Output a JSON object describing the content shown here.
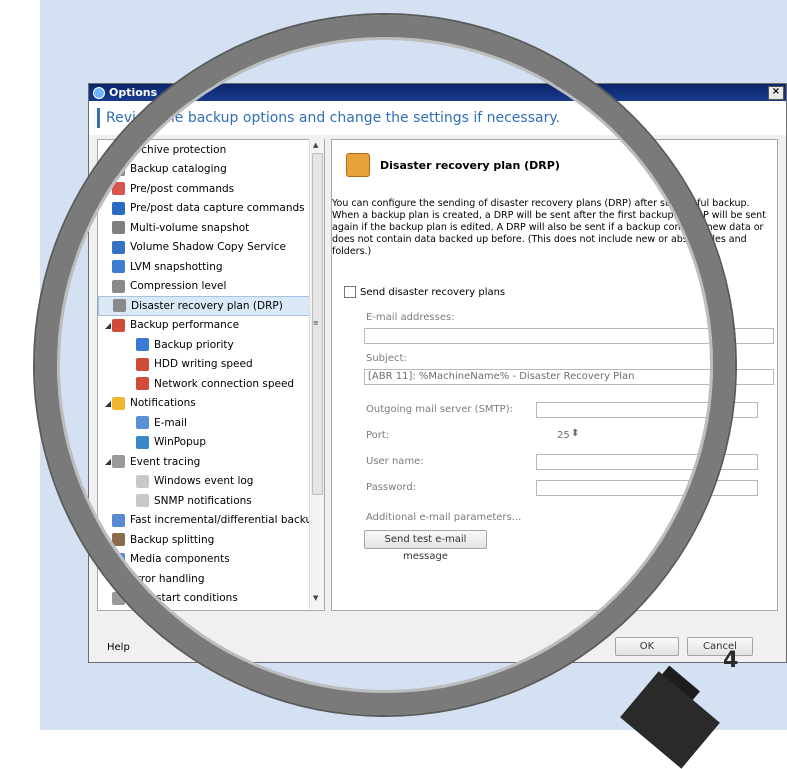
{
  "window": {
    "title": "Options",
    "close_glyph": "×"
  },
  "header": {
    "text": "Review the backup options and change the settings if necessary."
  },
  "tree": {
    "items": [
      {
        "label": "Archive protection",
        "icon": "lock-icon",
        "color": "#b38b3a",
        "level": 0
      },
      {
        "label": "Backup cataloging",
        "icon": "catalog-icon",
        "color": "#8a8a8a",
        "level": 0
      },
      {
        "label": "Pre/post commands",
        "icon": "clock-command-icon",
        "color": "#d9534f",
        "level": 0
      },
      {
        "label": "Pre/post data capture commands",
        "icon": "terminal-icon",
        "color": "#2a6cc1",
        "level": 0
      },
      {
        "label": "Multi-volume snapshot",
        "icon": "disks-icon",
        "color": "#7f7f7f",
        "level": 0
      },
      {
        "label": "Volume Shadow Copy Service",
        "icon": "vss-icon",
        "color": "#3572c6",
        "level": 0
      },
      {
        "label": "LVM snapshotting",
        "icon": "lvm-icon",
        "color": "#3c7dd1",
        "level": 0
      },
      {
        "label": "Compression level",
        "icon": "compression-icon",
        "color": "#8a8a8a",
        "level": 0
      },
      {
        "label": "Disaster recovery plan (DRP)",
        "icon": "drp-icon",
        "color": "#8a8a8a",
        "level": 0
      },
      {
        "label": "Backup performance",
        "icon": "performance-icon",
        "color": "#d14b3a",
        "level": 0,
        "expander": "◢"
      },
      {
        "label": "Backup priority",
        "icon": "priority-icon",
        "color": "#3a7bd5",
        "level": 1
      },
      {
        "label": "HDD writing speed",
        "icon": "hdd-speed-icon",
        "color": "#d14b3a",
        "level": 1
      },
      {
        "label": "Network connection speed",
        "icon": "network-speed-icon",
        "color": "#d14b3a",
        "level": 1
      },
      {
        "label": "Notifications",
        "icon": "notification-icon",
        "color": "#f2b632",
        "level": 0,
        "expander": "◢"
      },
      {
        "label": "E-mail",
        "icon": "email-icon",
        "color": "#5b8fd6",
        "level": 1
      },
      {
        "label": "WinPopup",
        "icon": "winpopup-icon",
        "color": "#3a88c9",
        "level": 1
      },
      {
        "label": "Event tracing",
        "icon": "event-trace-icon",
        "color": "#9a9a9a",
        "level": 0,
        "expander": "◢"
      },
      {
        "label": "Windows event log",
        "icon": "event-log-icon",
        "color": "#c8c8c8",
        "level": 1
      },
      {
        "label": "SNMP notifications",
        "icon": "snmp-icon",
        "color": "#c8c8c8",
        "level": 1
      },
      {
        "label": "Fast incremental/differential backup",
        "icon": "fast-backup-icon",
        "color": "#5a8ad1",
        "level": 0
      },
      {
        "label": "Backup splitting",
        "icon": "split-icon",
        "color": "#8a6b4a",
        "level": 0
      },
      {
        "label": "Media components",
        "icon": "media-icon",
        "color": "#5a8ad1",
        "level": 0
      },
      {
        "label": "Error handling",
        "icon": "error-icon",
        "color": "#d9342b",
        "level": 0
      },
      {
        "label": "Task start conditions",
        "icon": "conditions-icon",
        "color": "#9a9a9a",
        "level": 0
      }
    ],
    "selected_index": 8,
    "scroll_up": "▲",
    "scroll_down": "▼",
    "scroll_grip": "≡"
  },
  "pane": {
    "title": "Disaster recovery plan (DRP)",
    "description": "You can configure the sending of disaster recovery plans (DRP) after successful backup. When a backup plan is created, a DRP will be sent after the first backup. A DRP will be sent again if the backup plan is edited. A DRP will also be sent if a backup contains new data or does not contain data backed up before. (This does not include new or absent files and folders.)",
    "send_checkbox_label": "Send disaster recovery plans",
    "email_label": "E-mail addresses:",
    "email_value": "",
    "subject_label": "Subject:",
    "subject_value": "[ABR 11]: %MachineName% - Disaster Recovery Plan",
    "smtp_label": "Outgoing mail server (SMTP):",
    "port_label": "Port:",
    "port_value": "25",
    "port_stepper_glyph": "⬍",
    "username_label": "User name:",
    "password_label": "Password:",
    "additional_link": "Additional e-mail parameters...",
    "test_button": "Send test e-mail message"
  },
  "footer": {
    "help": "Help",
    "ok": "OK",
    "cancel": "Cancel"
  },
  "badge": "4"
}
